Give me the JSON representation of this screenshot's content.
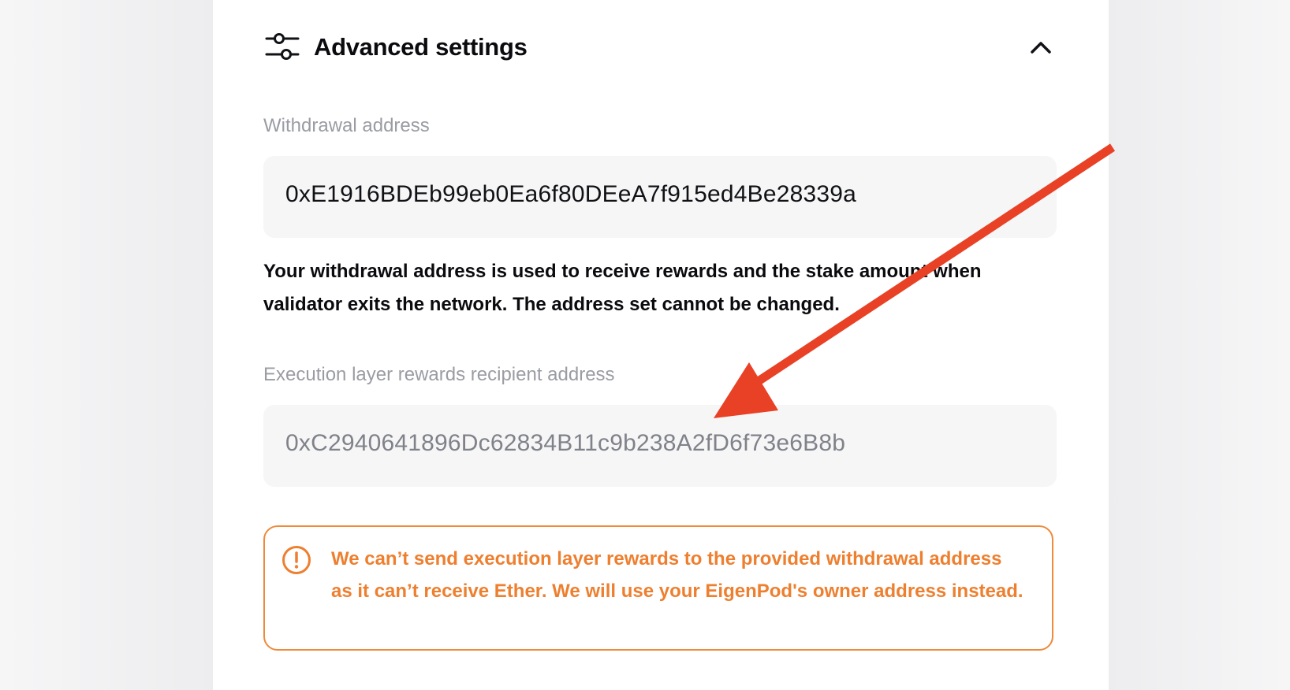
{
  "header": {
    "title": "Advanced settings",
    "settings_icon": "sliders-icon",
    "toggle_icon": "chevron-up-icon"
  },
  "withdrawal": {
    "label": "Withdrawal address",
    "value": "0xE1916BDEb99eb0Ea6f80DEeA7f915ed4Be28339a",
    "description": "Your withdrawal address is used to receive rewards and the stake amount when validator exits the network. The address set cannot be changed."
  },
  "execution": {
    "label": "Execution layer rewards recipient address",
    "value": "0xC2940641896Dc62834B11c9b238A2fD6f73e6B8b"
  },
  "alert": {
    "icon": "exclamation-circle-icon",
    "message": "We can’t send execution layer rewards to the provided withdrawal address as it can’t receive Ether. We will use your EigenPod's owner address instead."
  },
  "colors": {
    "warning": "#ee7f2f",
    "annotation_arrow": "#e84126",
    "label_gray": "#9a9ca3",
    "field_bg": "#f6f6f7"
  }
}
